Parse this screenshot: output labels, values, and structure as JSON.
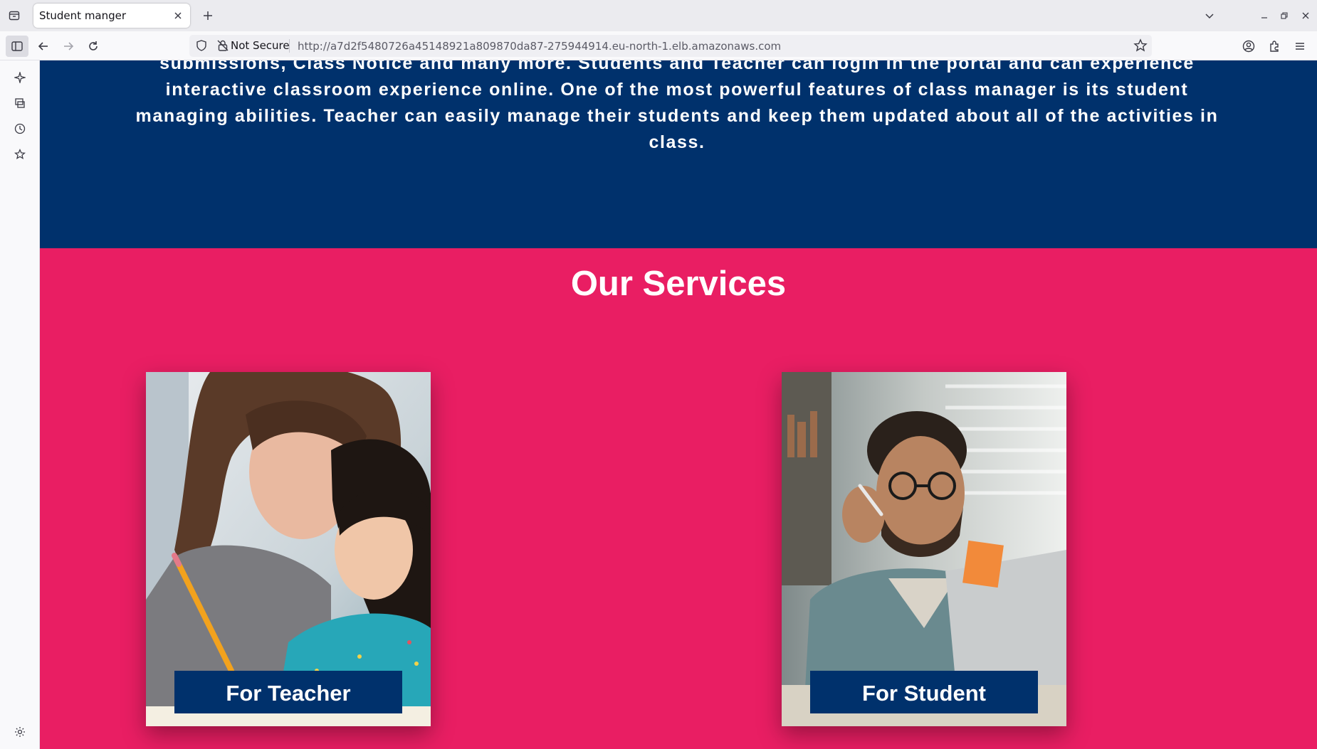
{
  "browser": {
    "tab_title": "Student manger",
    "url_security": "Not Secure",
    "url": "http://a7d2f5480726a45148921a809870da87-275944914.eu-north-1.elb.amazonaws.com"
  },
  "about": {
    "lines": [
      "submissions, Class Notice and many more. Students and Teacher can login in the portal and can experience",
      "interactive classroom experience online. One of the most powerful features of class manager is its student",
      "managing abilities. Teacher can easily manage their students and keep them updated about all of the activities in",
      "class."
    ]
  },
  "services": {
    "title": "Our Services",
    "cards": [
      {
        "label": "For Teacher",
        "image": "teacher-with-child-photo"
      },
      {
        "label": "For Student",
        "image": "student-with-laptop-photo"
      }
    ]
  },
  "colors": {
    "about_bg": "#00316c",
    "services_bg": "#e91e63",
    "label_bg": "#00316c",
    "text": "#ffffff"
  }
}
